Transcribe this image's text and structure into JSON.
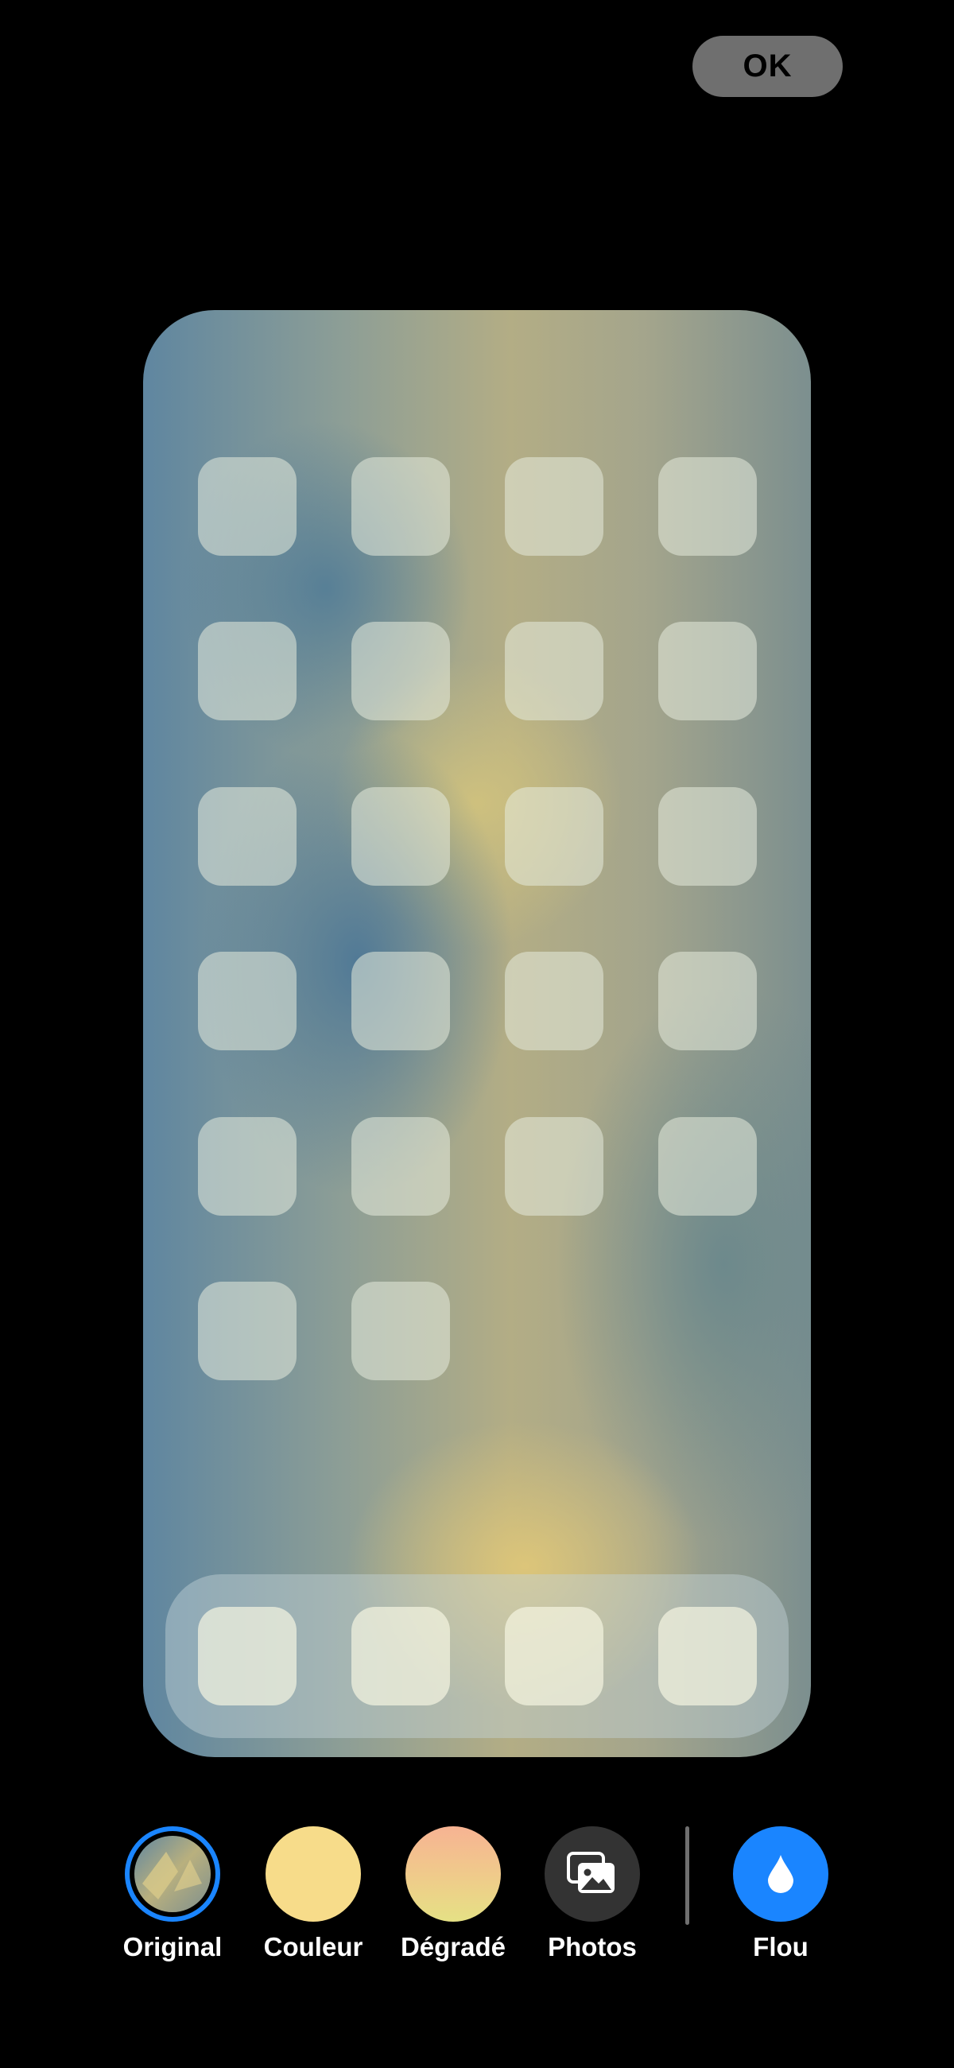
{
  "header": {
    "ok_label": "OK"
  },
  "toolbar": {
    "original_label": "Original",
    "color_label": "Couleur",
    "gradient_label": "Dégradé",
    "photos_label": "Photos",
    "blur_label": "Flou"
  },
  "colors": {
    "accent": "#1a85ff",
    "color_swatch": "#f7dc8a",
    "gradient_top": "#f7b393",
    "gradient_bottom": "#e5e185",
    "ok_bg": "#6f6f6f"
  },
  "icons": {
    "photos": "photos-stack-icon",
    "blur": "water-drop-icon"
  },
  "home_preview": {
    "grid_rows": 6,
    "grid_columns": 4,
    "app_count": 22,
    "dock_app_count": 4
  }
}
